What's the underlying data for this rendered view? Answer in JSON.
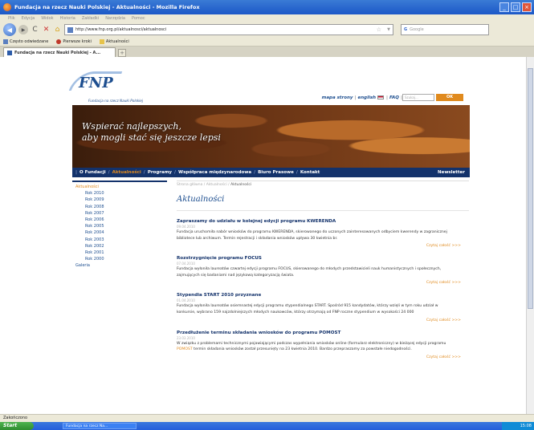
{
  "window": {
    "title": "Fundacja na rzecz Nauki Polskiej - Aktualności - Mozilla Firefox",
    "controls": [
      "_",
      "□",
      "×"
    ]
  },
  "menubar": [
    "Plik",
    "Edycja",
    "Widok",
    "Historia",
    "Zakładki",
    "Narzędzia",
    "Pomoc"
  ],
  "navbar": {
    "url": "http://www.fnp.org.pl/aktualnosci/aktualnosci",
    "search_engine": "Google",
    "search_placeholder": "Google"
  },
  "bookmarks": [
    {
      "label": "Często odwiedzane",
      "icon": "page-icon"
    },
    {
      "label": "Pierwsze kroki",
      "icon": "firefox-icon"
    },
    {
      "label": "Aktualności",
      "icon": "rss-icon"
    }
  ],
  "tabs": [
    {
      "label": "Fundacja na rzecz Nauki Polskiej - A..."
    }
  ],
  "site": {
    "logo": "FNP",
    "logo_sub": "Fundacja na rzecz Nauki Polskiej",
    "toplinks": {
      "sitemap": "mapa strony",
      "english": "english",
      "faq": "FAQ"
    },
    "search_placeholder": "Szukaj...",
    "ok_label": "OK",
    "slogan_line1": "Wspierać najlepszych,",
    "slogan_line2": "aby mogli stać się jeszcze lepsi",
    "nav": [
      "O Fundacji",
      "Aktualności",
      "Programy",
      "Współpraca międzynarodowa",
      "Biuro Prasowe",
      "Kontakt"
    ],
    "nav_right": "Newsletter",
    "sidebar": [
      {
        "label": "Aktualności",
        "sub": false,
        "active": true
      },
      {
        "label": "Rok 2010",
        "sub": true
      },
      {
        "label": "Rok 2009",
        "sub": true
      },
      {
        "label": "Rok 2008",
        "sub": true
      },
      {
        "label": "Rok 2007",
        "sub": true
      },
      {
        "label": "Rok 2006",
        "sub": true
      },
      {
        "label": "Rok 2005",
        "sub": true
      },
      {
        "label": "Rok 2004",
        "sub": true
      },
      {
        "label": "Rok 2003",
        "sub": true
      },
      {
        "label": "Rok 2002",
        "sub": true
      },
      {
        "label": "Rok 2001",
        "sub": true
      },
      {
        "label": "Rok 2000",
        "sub": true
      },
      {
        "label": "Galeria",
        "sub": false
      }
    ],
    "breadcrumb": {
      "home": "Strona główna",
      "section": "Aktualności",
      "current": "Aktualności",
      "sep": " / "
    },
    "page_title": "Aktualności",
    "read_more": "Czytaj całość >>>",
    "articles": [
      {
        "title": "Zapraszamy do udziału w kolejnej edycji programu KWERENDA",
        "date": "09.04.2010",
        "body": "Fundacja uruchomiła nabór wniosków do programu KWERENDA, skierowanego do uczonych zainteresowanych odbyciem kwerendy w zagranicznej bibliotece lub archiwum. Termin rejestracji i składania wniosków upływa 30 kwietnia br."
      },
      {
        "title": "Rozstrzygnięcie programu FOCUS",
        "date": "07.04.2010",
        "body": "Fundacja wyłoniła laureatów czwartej edycji programu FOCUS, skierowanego do młodych przedstawicieli nauk humanistycznych i społecznych, zajmujących się badaniami nad językową kategoryzacją świata."
      },
      {
        "title": "Stypendia START 2010 przyznane",
        "date": "01.04.2010",
        "body": "Fundacja wyłoniła laureatów osiemnastej edycji programu stypendialnego START. Spośród 915 kandydatów, którzy wzięli w tym roku udział w konkursie, wybrano 159 najzdolniejszych młodych naukowców, którzy otrzymają od FNP roczne stypendium w wysokości 24 000"
      },
      {
        "title": "Przedłużenie terminu składania wniosków do programu POMOST",
        "date": "23.03.2010",
        "body_pre": "W związku z problemami technicznymi pojawiającymi podczas wypełniania wniosków online (formularz elektroniczny) w bieżącej edycji programu ",
        "body_hl": "POMOST",
        "body_post": " termin składania wniosków został przesunięty na 23 kwietnia 2010. Bardzo przepraszamy za powstałe niedogodności."
      }
    ]
  },
  "statusbar": "Zakończono",
  "taskbar": {
    "start": "Start",
    "task": "Fundacja na rzecz Na...",
    "clock": "15:08"
  }
}
